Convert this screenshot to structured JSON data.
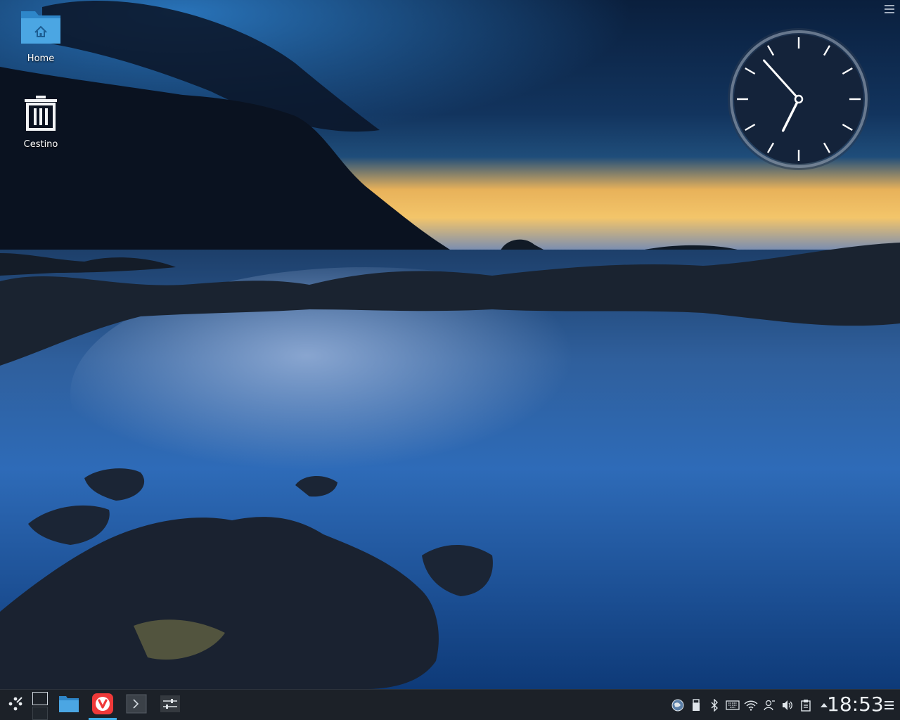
{
  "desktop": {
    "icons": [
      {
        "label": "Home",
        "icon": "folder-home-icon"
      },
      {
        "label": "Cestino",
        "icon": "trash-icon"
      }
    ]
  },
  "clock_widget": {
    "hours": 18,
    "minutes": 53
  },
  "panel": {
    "launchers": [
      {
        "name": "application-launcher",
        "icon": "kde-launcher-icon"
      },
      {
        "name": "file-manager",
        "icon": "folder-icon"
      },
      {
        "name": "vivaldi-browser",
        "icon": "vivaldi-icon",
        "active": true
      },
      {
        "name": "terminal",
        "icon": "terminal-icon"
      },
      {
        "name": "system-settings",
        "icon": "settings-sliders-icon"
      }
    ],
    "tray": [
      "network-globe-icon",
      "usb-device-icon",
      "bluetooth-icon",
      "keyboard-icon",
      "wifi-icon",
      "user-switch-icon",
      "volume-icon",
      "clipboard-icon",
      "expand-tray-arrow-icon"
    ],
    "clock": "18:53"
  },
  "colors": {
    "accent": "#3daee9",
    "panel_bg": "#1c2128",
    "vivaldi_red": "#ef3939"
  }
}
